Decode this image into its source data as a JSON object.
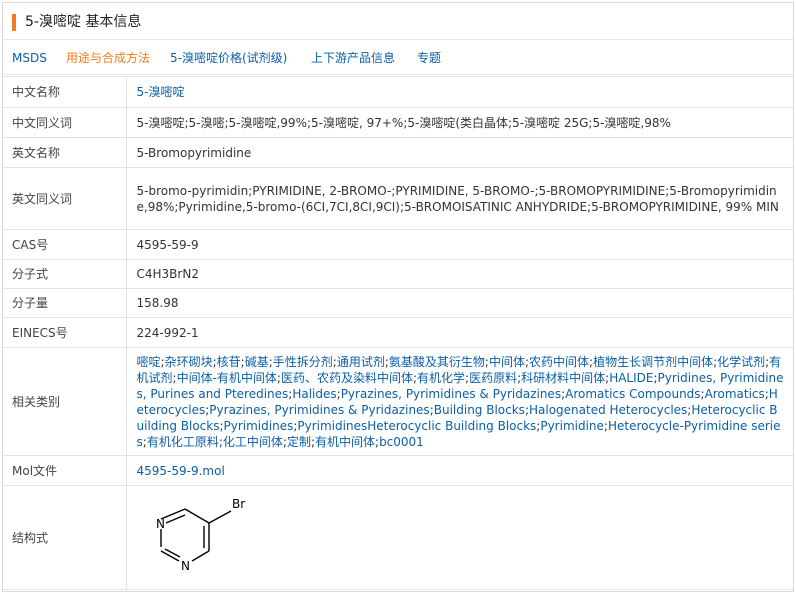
{
  "header": {
    "title": "5-溴嘧啶 基本信息"
  },
  "tabs": [
    {
      "label": "MSDS",
      "active": false
    },
    {
      "label": "用途与合成方法",
      "active": true
    },
    {
      "label": "5-溴嘧啶价格(试剂级)",
      "active": false
    },
    {
      "label": "上下游产品信息",
      "active": false
    },
    {
      "label": "专题",
      "active": false
    }
  ],
  "rows": {
    "chinese_name": {
      "label": "中文名称",
      "value": "5-溴嘧啶"
    },
    "chinese_synonyms": {
      "label": "中文同义词",
      "value": "5-溴嘧啶;5-溴嘧;5-溴嘧啶,99%;5-溴嘧啶, 97+%;5-溴嘧啶(类白晶体;5-溴嘧啶 25G;5-溴嘧啶,98%"
    },
    "english_name": {
      "label": "英文名称",
      "value": "5-Bromopyrimidine"
    },
    "english_synonyms": {
      "label": "英文同义词",
      "value": "5-bromo-pyrimidin;PYRIMIDINE, 2-BROMO-;PYRIMIDINE, 5-BROMO-;5-BROMOPYRIMIDINE;5-Bromopyrimidine,98%;Pyrimidine,5-bromo-(6CI,7CI,8CI,9CI);5-BROMOISATINIC ANHYDRIDE;5-BROMOPYRIMIDINE, 99% MIN"
    },
    "cas": {
      "label": "CAS号",
      "value": "4595-59-9"
    },
    "formula": {
      "label": "分子式",
      "value": "C4H3BrN2"
    },
    "mol_weight": {
      "label": "分子量",
      "value": "158.98"
    },
    "einecs": {
      "label": "EINECS号",
      "value": "224-992-1"
    },
    "categories": {
      "label": "相关类别",
      "items": [
        "嘧啶",
        "杂环砌块",
        "核苷",
        "碱基",
        "手性拆分剂",
        "通用试剂",
        "氨基酸及其衍生物",
        "中间体",
        "农药中间体",
        "植物生长调节剂中间体",
        "化学试剂",
        "有机试剂",
        "中间体-有机中间体",
        "医药、农药及染料中间体",
        "有机化学",
        "医药原料",
        "科研材料中间体",
        "HALIDE",
        "Pyridines, Pyrimidines, Purines and Pteredines",
        "Halides",
        "Pyrazines, Pyrimidines & Pyridazines",
        "Aromatics Compounds",
        "Aromatics",
        "Heterocycles",
        "Pyrazines, Pyrimidines & Pyridazines",
        "Building Blocks",
        "Halogenated Heterocycles",
        "Heterocyclic Building Blocks",
        "Pyrimidines",
        "PyrimidinesHeterocyclic Building Blocks",
        "Pyrimidine",
        "Heterocycle-Pyrimidine series",
        "有机化工原料",
        "化工中间体",
        "定制",
        "有机中间体",
        "bc0001"
      ],
      "separator": ";"
    },
    "mol_file": {
      "label": "Mol文件",
      "value": "4595-59-9.mol"
    },
    "structure": {
      "label": "结构式",
      "atoms": {
        "br": "Br",
        "n1": "N",
        "n2": "N"
      }
    }
  },
  "colors": {
    "accent": "#f07c25",
    "link": "#0a5fa8",
    "active_tab": "#ef7d22",
    "border": "#e3e3e3"
  }
}
